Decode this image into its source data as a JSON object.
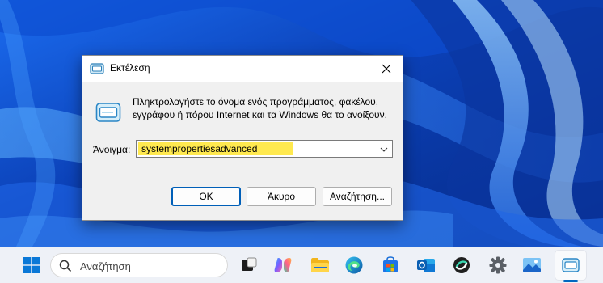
{
  "dialog": {
    "title": "Εκτέλεση",
    "description": "Πληκτρολογήστε το όνομα ενός προγράμματος, φακέλου, εγγράφου ή πόρου Internet και τα Windows θα το ανοίξουν.",
    "open_label": "Άνοιγμα:",
    "open_value": "systempropertiesadvanced",
    "ok_label": "OK",
    "cancel_label": "Άκυρο",
    "browse_label": "Αναζήτηση..."
  },
  "taskbar": {
    "search_placeholder": "Αναζήτηση",
    "icons": [
      "start-icon",
      "search-icon",
      "task-view-icon",
      "copilot-icon",
      "file-explorer-icon",
      "edge-icon",
      "microsoft-store-icon",
      "outlook-icon",
      "app-icon",
      "settings-icon",
      "photos-icon",
      "run-icon"
    ]
  },
  "colors": {
    "highlight": "#ffe94f",
    "accent": "#0067c0",
    "wallpaper": "#0a3fb8"
  }
}
